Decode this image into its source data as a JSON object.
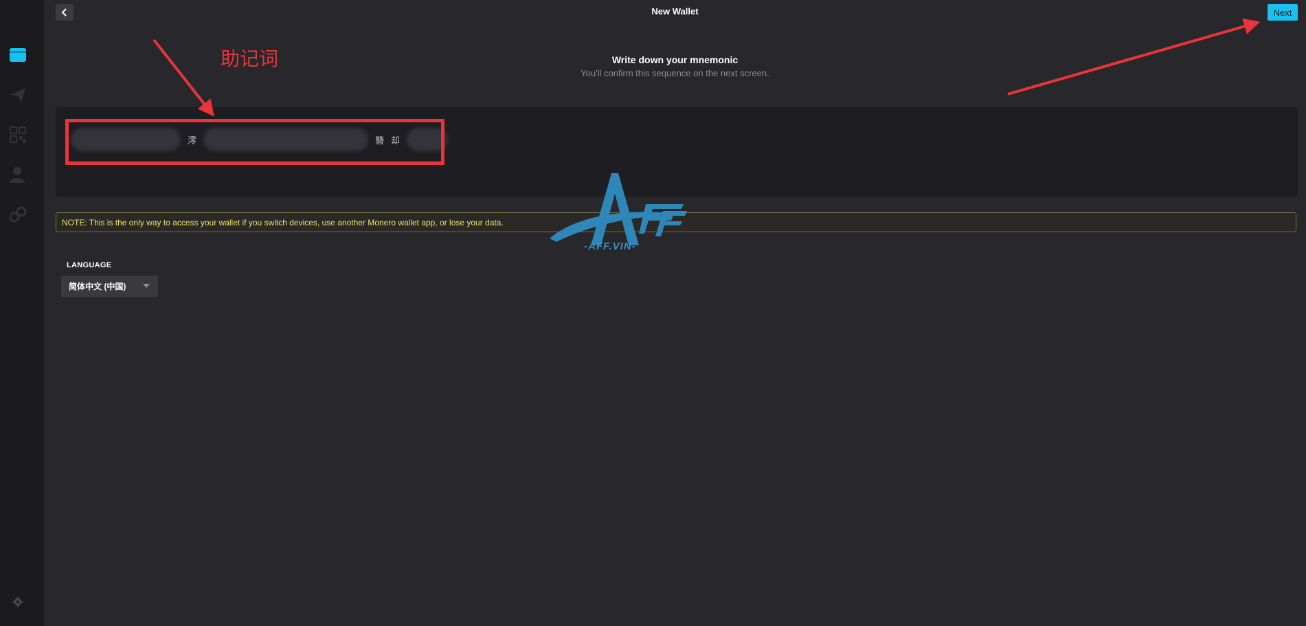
{
  "header": {
    "title": "New Wallet",
    "next_label": "Next"
  },
  "main": {
    "heading": "Write down your mnemonic",
    "subheading": "You'll confirm this sequence on the next screen.",
    "mnemonic_visible_chars": [
      "澪",
      "簪",
      "却"
    ],
    "note": "NOTE: This is the only way to access your wallet if you switch devices, use another Monero wallet app, or lose your data.",
    "language": {
      "label": "LANGUAGE",
      "selected": "简体中文 (中国)"
    }
  },
  "annotation": {
    "label": "助记词",
    "color": "#e8343a"
  },
  "watermark": {
    "text": "-AFF.VIN-",
    "logo": "AFF"
  },
  "colors": {
    "accent": "#19c1f0",
    "background": "#28272b",
    "sidebar": "#1b1a1d",
    "note_text": "#f2e06a"
  },
  "sidebar": {
    "icons": [
      "wallet-icon",
      "send-icon",
      "qr-code-icon",
      "contacts-icon",
      "network-icon",
      "settings-icon"
    ]
  }
}
